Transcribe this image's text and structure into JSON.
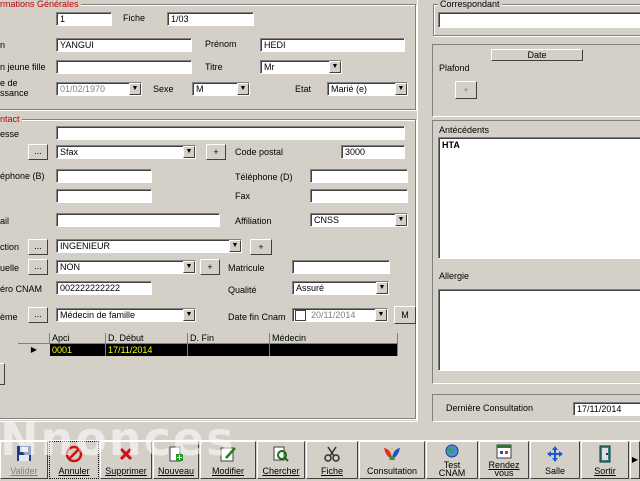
{
  "general": {
    "group_title": "rmations Générales",
    "num_value": "1",
    "fiche_label": "Fiche",
    "fiche_value": "1/03",
    "nom_label": "n",
    "nom_value": "YANGUI",
    "prenom_label": "Prénom",
    "prenom_value": "HEDI",
    "jeune_fille_label": "n jeune fille",
    "jeune_fille_value": "",
    "titre_label": "Titre",
    "titre_value": "Mr",
    "naissance_label1": "e de",
    "naissance_label2": "ssance",
    "naissance_value": "01/02/1970",
    "sexe_label": "Sexe",
    "sexe_value": "M",
    "etat_label": "Etat",
    "etat_value": "Marié (e)"
  },
  "contact": {
    "group_title": "ntact",
    "adresse_label": "esse",
    "adresse_value": "",
    "ville_btn": "...",
    "ville_value": "Sfax",
    "plus_btn": "+",
    "code_postal_label": "Code postal",
    "code_postal_value": "3000",
    "tel_b_label": "éphone (B)",
    "tel_b_value": "",
    "tel_d_label": "Téléphone (D)",
    "tel_d_value": "",
    "fax_label": "Fax",
    "fax_value": "",
    "left3_label": "",
    "left3_value": "",
    "mail_label": "ail",
    "mail_value": "",
    "affiliation_label": "Affiliation",
    "affiliation_value": "CNSS",
    "fonction_label": "ction",
    "fonction_value": "INGENIEUR",
    "mutuelle_label": "uelle",
    "mutuelle_value": "NON",
    "matricule_label": "Matricule",
    "matricule_value": "",
    "cnam_label": "éro CNAM",
    "cnam_value": "002222222222",
    "qualite_label": "Qualité",
    "qualite_value": "Assuré",
    "systeme_label": "ème",
    "systeme_value": "Médecin de famille",
    "date_fin_label": "Date fin Cnam",
    "date_fin_value": "20/11/2014",
    "m_btn": "M"
  },
  "grid": {
    "columns": [
      "Apci",
      "D. Début",
      "D. Fin",
      "Médecin"
    ],
    "rows": [
      [
        "0001",
        "17/11/2014",
        "",
        ""
      ]
    ]
  },
  "right": {
    "correspondant_title": "Correspondant",
    "correspondant_value": "",
    "date_header": "Date",
    "plafond_label": "Plafond",
    "plafond_btn": "+",
    "antecedents_label": "Antécédents",
    "antecedents_value": "HTA",
    "allergie_label": "Allergie",
    "allergie_value": "",
    "derniere_label": "Dernière Consultation",
    "derniere_value": "17/11/2014"
  },
  "toolbar": {
    "valider": "Valider",
    "annuler": "Annuler",
    "supprimer": "Supprimer",
    "nouveau": "Nouveau",
    "modifier": "Modifier",
    "chercher": "Chercher",
    "fiche": "Fiche",
    "consultation": "Consultation",
    "test_cnam_1": "Test",
    "test_cnam_2": "CNAM",
    "rdv_1": "Rendez",
    "rdv_2": "vous",
    "salle": "Salle",
    "sortir": "Sortir"
  },
  "watermark": "Nnonces",
  "colors": {
    "window_bg": "#d4d0c8",
    "group_title_red": "#c00000",
    "grid_selected_bg": "#000000",
    "grid_selected_fg": "#ffff00"
  }
}
